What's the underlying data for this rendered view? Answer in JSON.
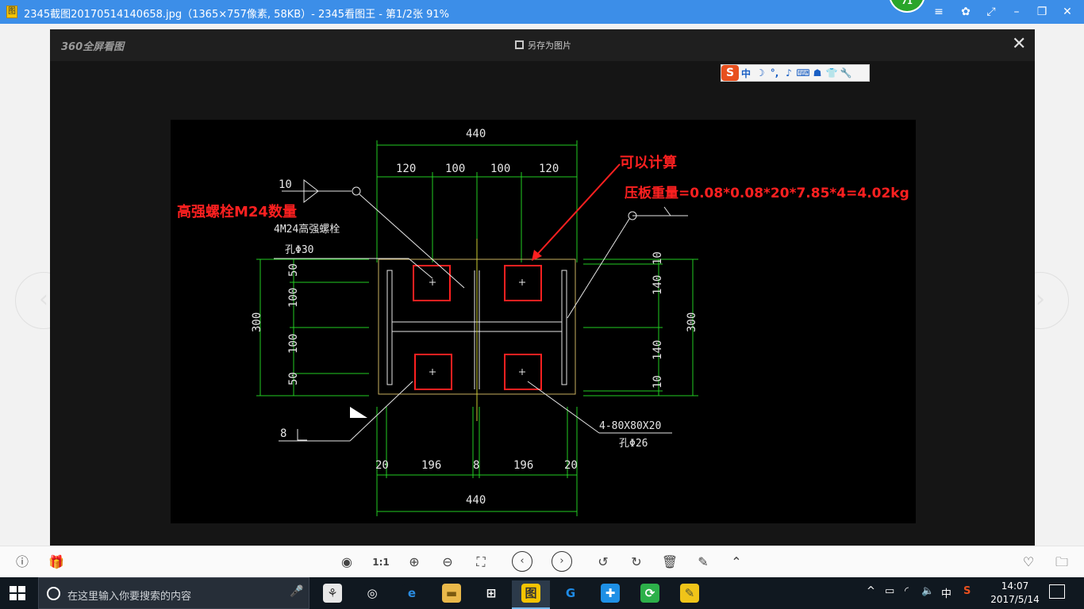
{
  "window": {
    "title": "2345截图20170514140658.jpg（1365×757像素, 58KB）- 2345看图王 - 第1/2张 91%",
    "app_icon": "图",
    "badge": "71",
    "buttons": {
      "menu": "≡",
      "skin": "✿",
      "fullscreen": "⤢",
      "minimize": "–",
      "restore": "❐",
      "close": "✕"
    }
  },
  "viewer": {
    "logo": "360全屏看图",
    "save_label": "另存为图片",
    "close": "✕",
    "prev": "‹",
    "next": "›"
  },
  "ime": {
    "logo": "S",
    "items": [
      "中",
      "☽",
      "°,",
      "♪",
      "⌨",
      "☗",
      "👕",
      "🔧"
    ]
  },
  "drawing": {
    "annotations": {
      "bolt_label": "高强螺栓M24数量",
      "can_calc": "可以计算",
      "plate_weight": "压板重量=0.08*0.08*20*7.85*4=4.02kg"
    },
    "dims": {
      "top_total": "440",
      "top_segs": [
        "120",
        "100",
        "100",
        "120"
      ],
      "bottom_total": "440",
      "bottom_segs": [
        "20",
        "196",
        "8",
        "196",
        "20"
      ],
      "left_total": "300",
      "left_segs": [
        "50",
        "100",
        "100",
        "50"
      ],
      "right_total": "300",
      "right_segs": [
        "10",
        "140",
        "140",
        "10"
      ]
    },
    "labels": {
      "weld_top": "10",
      "weld_bottom": "8",
      "bolt_spec": "4M24高强螺栓",
      "bolt_hole": "孔Φ30",
      "plate_spec": "4-80X80X20",
      "plate_hole": "孔Φ26"
    }
  },
  "toolbar": {
    "info": "ⓘ",
    "gift": "🎁",
    "items": [
      "◉",
      "1:1",
      "⊕",
      "⊖",
      "⛶",
      "‹",
      "›",
      "↺",
      "↻",
      "🗑",
      "✎",
      "⌃"
    ],
    "favorite": "♡",
    "folder": "🗀"
  },
  "taskbar": {
    "search_placeholder": "在这里输入你要搜索的内容",
    "mic": "🎤",
    "apps": [
      {
        "glyph": "⚘",
        "bg": "#e8e8e8",
        "fg": "#333"
      },
      {
        "glyph": "◎",
        "bg": "#101820",
        "fg": "#fff"
      },
      {
        "glyph": "e",
        "bg": "#101820",
        "fg": "#2a8be0"
      },
      {
        "glyph": "▬",
        "bg": "#e9b84a",
        "fg": "#7a5a10"
      },
      {
        "glyph": "⊞",
        "bg": "#101820",
        "fg": "#fff"
      },
      {
        "glyph": "图",
        "bg": "#f5c400",
        "fg": "#333"
      },
      {
        "glyph": "G",
        "bg": "#101820",
        "fg": "#1e8be6"
      },
      {
        "glyph": "✚",
        "bg": "#1e90e6",
        "fg": "#fff"
      },
      {
        "glyph": "⟳",
        "bg": "#2db04a",
        "fg": "#fff"
      },
      {
        "glyph": "✎",
        "bg": "#f0c419",
        "fg": "#553"
      }
    ],
    "tray": {
      "chevron": "^",
      "network": "▭",
      "wifi": "◜",
      "volume": "🔈",
      "ime": "中",
      "sogou": "S"
    },
    "time": "14:07",
    "date": "2017/5/14"
  }
}
